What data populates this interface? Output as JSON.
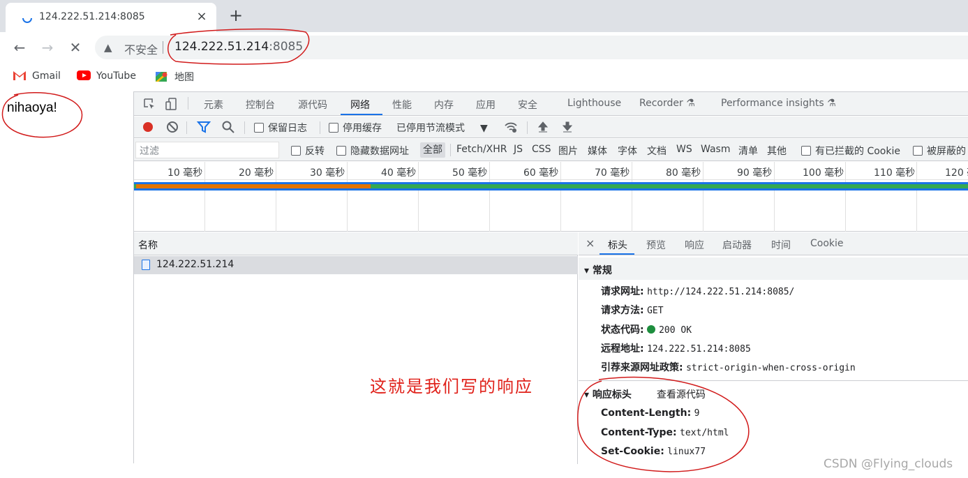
{
  "browser": {
    "tab": {
      "title": "124.222.51.214:8085",
      "close": "×"
    },
    "new_tab": "+",
    "nav": {
      "back": "←",
      "forward": "→",
      "stop": "✕"
    },
    "omnibox": {
      "security_label": "不安全",
      "host": "124.222.51.214",
      "port": ":8085"
    },
    "bookmarks": [
      {
        "label": "Gmail",
        "icon": "gmail-icon"
      },
      {
        "label": "YouTube",
        "icon": "youtube-icon"
      },
      {
        "label": "地图",
        "icon": "maps-icon"
      }
    ]
  },
  "page": {
    "text": "nihaoya!"
  },
  "devtools": {
    "tabs": [
      "元素",
      "控制台",
      "源代码",
      "网络",
      "性能",
      "内存",
      "应用",
      "安全",
      "Lighthouse",
      "Recorder",
      "Performance insights"
    ],
    "active_tab": "网络",
    "toolbar": {
      "preserve_log": "保留日志",
      "disable_cache": "停用缓存",
      "throttling": "已停用节流模式"
    },
    "filter": {
      "placeholder": "过滤",
      "invert": "反转",
      "hide_data_urls": "隐藏数据网址",
      "types": [
        "全部",
        "Fetch/XHR",
        "JS",
        "CSS",
        "图片",
        "媒体",
        "字体",
        "文档",
        "WS",
        "Wasm",
        "清单",
        "其他"
      ],
      "blocked_cookies": "有已拦截的 Cookie",
      "blocked_requests": "被屏蔽的"
    },
    "timeline": {
      "labels": [
        "10 毫秒",
        "20 毫秒",
        "30 毫秒",
        "40 毫秒",
        "50 毫秒",
        "60 毫秒",
        "70 毫秒",
        "80 毫秒",
        "90 毫秒",
        "100 毫秒",
        "110 毫秒",
        "120 毫"
      ]
    },
    "requests": {
      "column_name": "名称",
      "rows": [
        {
          "name": "124.222.51.214"
        }
      ]
    },
    "detail": {
      "close": "×",
      "tabs": [
        "标头",
        "预览",
        "响应",
        "启动器",
        "时间",
        "Cookie"
      ],
      "active_tab": "标头",
      "general": {
        "title": "常规",
        "request_url_label": "请求网址:",
        "request_url": "http://124.222.51.214:8085/",
        "method_label": "请求方法:",
        "method": "GET",
        "status_label": "状态代码:",
        "status": "200 OK",
        "status_color": "#1e8e3e",
        "remote_label": "远程地址:",
        "remote": "124.222.51.214:8085",
        "referrer_label": "引荐来源网址政策:",
        "referrer": "strict-origin-when-cross-origin"
      },
      "response_headers": {
        "title": "响应标头",
        "view_source": "查看源代码",
        "items": [
          {
            "k": "Content-Length:",
            "v": "9"
          },
          {
            "k": "Content-Type:",
            "v": "text/html"
          },
          {
            "k": "Set-Cookie:",
            "v": "linux77"
          }
        ]
      }
    }
  },
  "annotation": {
    "text": "这就是我们写的响应",
    "color": "#e0221b"
  },
  "watermark": "CSDN @Flying_clouds"
}
